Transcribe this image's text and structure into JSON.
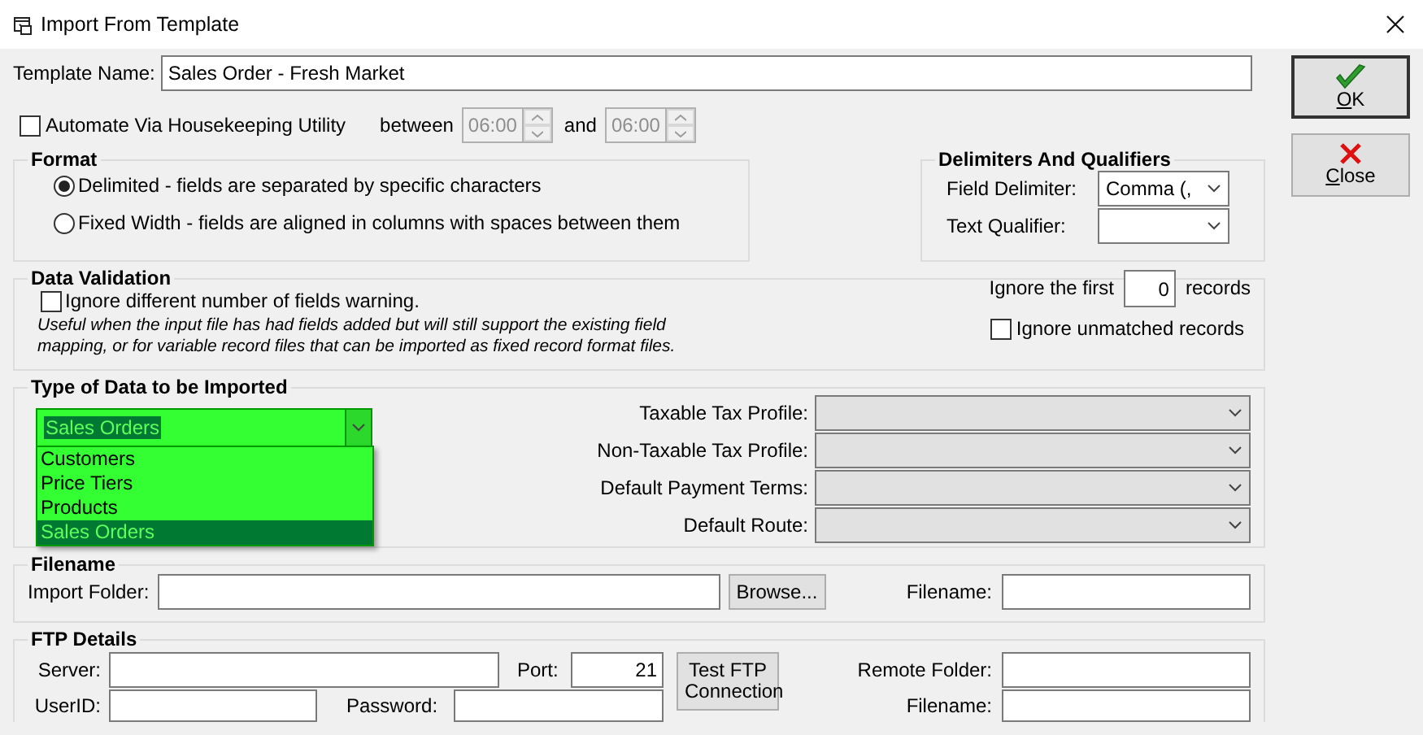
{
  "window": {
    "title": "Import From Template"
  },
  "template_name": {
    "label": "Template Name:",
    "value": "Sales Order - Fresh Market"
  },
  "automate": {
    "label": "Automate Via Housekeeping Utility",
    "checked": false,
    "between_label": "between",
    "start": "06:00",
    "and_label": "and",
    "end": "06:00",
    "disabled": true
  },
  "format": {
    "title": "Format",
    "options": [
      {
        "label": "Delimited - fields are separated by specific characters",
        "selected": true
      },
      {
        "label": "Fixed Width - fields are aligned in columns with spaces between them",
        "selected": false
      }
    ]
  },
  "delimiters": {
    "title": "Delimiters And Qualifiers",
    "fields": [
      {
        "label": "Field Delimiter:",
        "value": "Comma (,"
      },
      {
        "label": "Text Qualifier:"
      }
    ]
  },
  "data_validation": {
    "title": "Data Validation",
    "ignore_fields": {
      "label": "Ignore different number of fields warning.",
      "checked": false
    },
    "note": "Useful when the input file has had fields added but will still support the existing field mapping, or for variable record files that can be imported as fixed record format files.",
    "skip_label": "Ignore the first",
    "skip_value": "0",
    "skip_suffix": "records",
    "ignore_unmatched": {
      "label": "Ignore unmatched records",
      "checked": false
    }
  },
  "data_type": {
    "title": "Type of Data to be Imported",
    "value": "Sales Orders",
    "expanded": true,
    "options": [
      {
        "label": "Customers",
        "selected": false
      },
      {
        "label": "Price Tiers",
        "selected": false
      },
      {
        "label": "Products",
        "selected": false
      },
      {
        "label": "Sales Orders",
        "selected": true
      }
    ],
    "profiles": [
      {
        "label": "Taxable Tax Profile:",
        "disabled": true
      },
      {
        "label": "Non-Taxable Tax Profile:",
        "disabled": true
      },
      {
        "label": "Default Payment Terms:",
        "disabled": true
      },
      {
        "label": "Default Route:",
        "disabled": true
      }
    ]
  },
  "filename": {
    "title": "Filename",
    "folder_label": "Import Folder:",
    "browse_button": "Browse...",
    "filename_label": "Filename:"
  },
  "ftp": {
    "title": "FTP Details",
    "server_label": "Server:",
    "port_label": "Port:",
    "port": "21",
    "test_button": "Test FTP Connection",
    "remote_folder_label": "Remote Folder:",
    "userid_label": "UserID:",
    "password_label": "Password:",
    "filename_label": "Filename:"
  },
  "buttons": [
    {
      "kind": "ok",
      "label": "OK"
    },
    {
      "kind": "close",
      "label": "Close"
    }
  ]
}
